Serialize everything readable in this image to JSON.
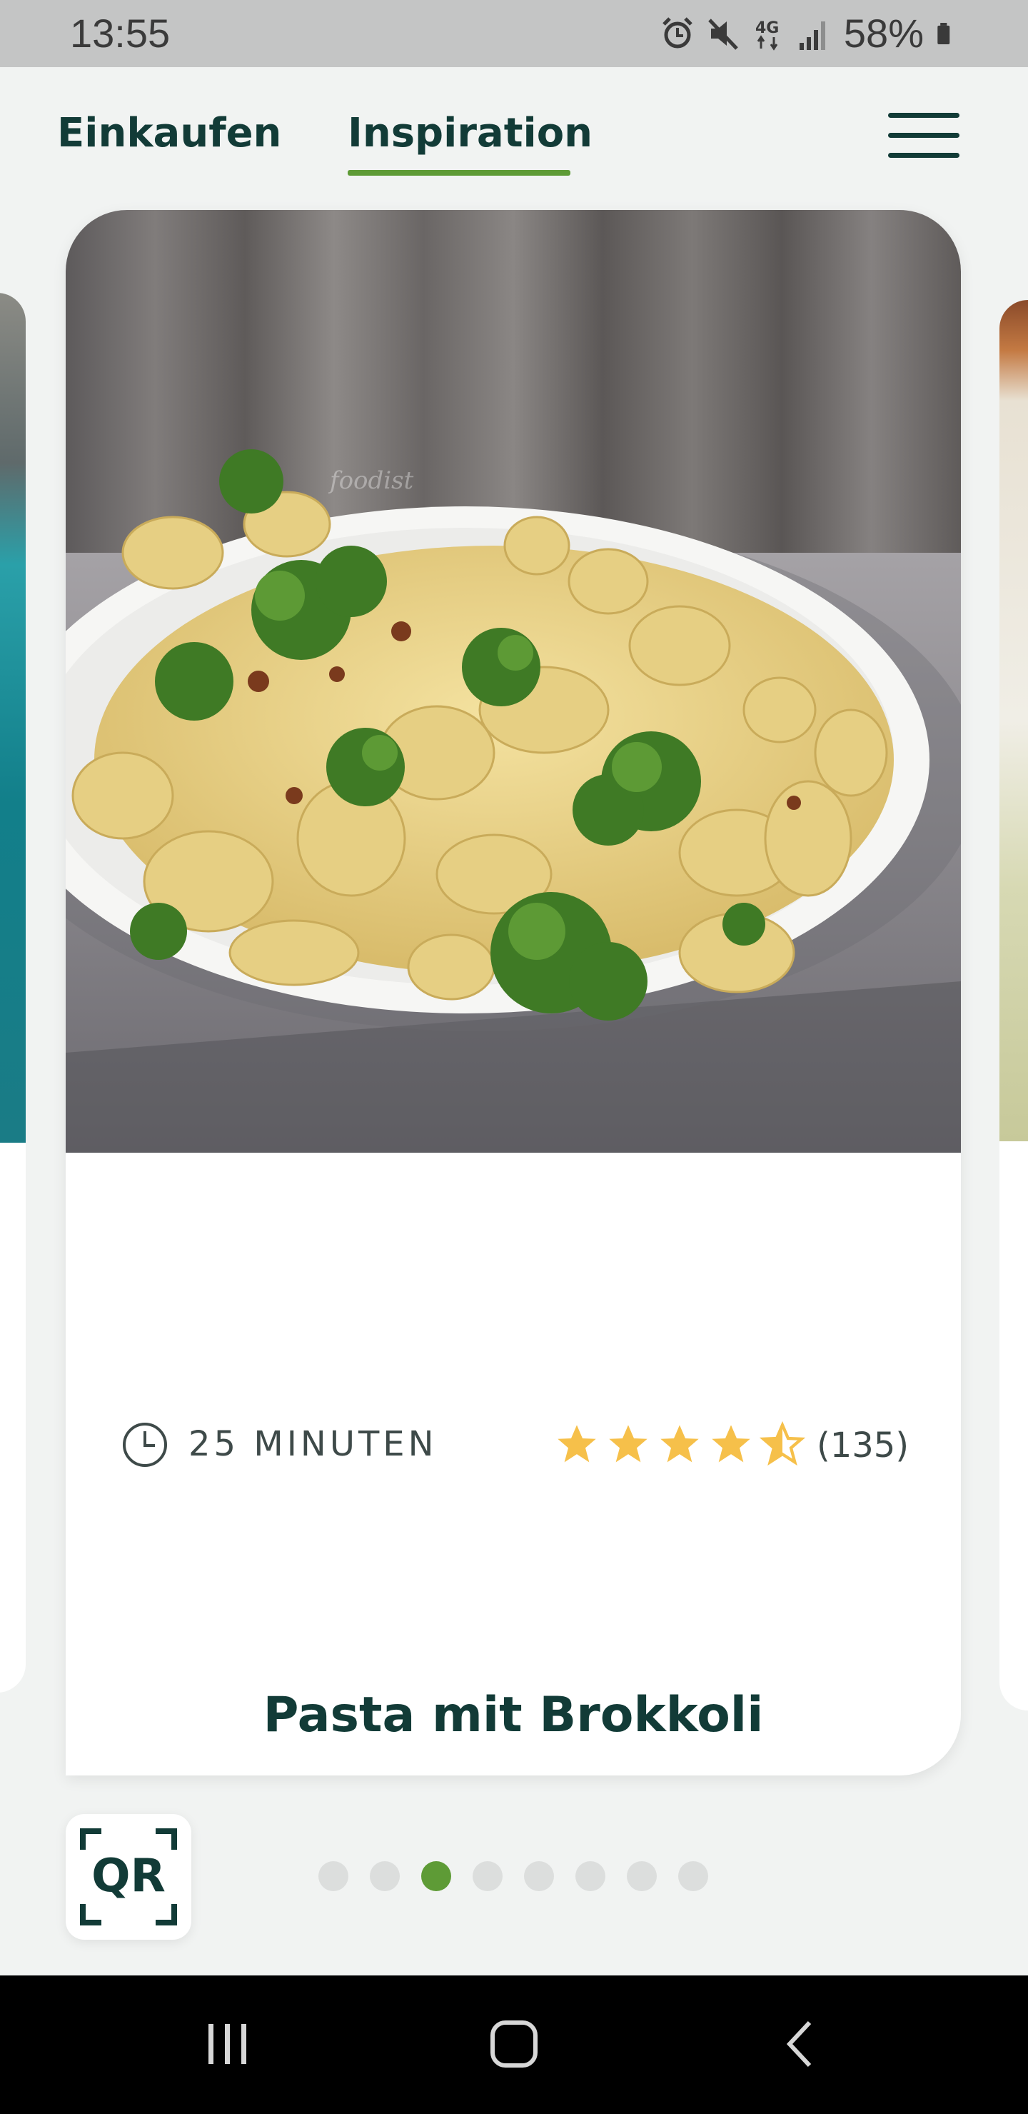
{
  "status_bar": {
    "time": "13:55",
    "network": "4G",
    "battery": "58%",
    "icons": [
      "alarm-icon",
      "mute-icon",
      "4g-icon",
      "signal-icon",
      "battery-icon"
    ]
  },
  "nav": {
    "tabs": [
      {
        "label": "Einkaufen",
        "active": false
      },
      {
        "label": "Inspiration",
        "active": true
      }
    ],
    "menu_icon": "hamburger-menu-icon"
  },
  "recipe": {
    "duration": "25 MINUTEN",
    "rating": 4.5,
    "rating_count": "(135)",
    "title": "Pasta mit Brokkoli",
    "photo_watermark": "foodist"
  },
  "qr_button": {
    "label": "QR"
  },
  "pagination": {
    "total": 8,
    "active_index": 2
  },
  "colors": {
    "brand_dark": "#123b37",
    "accent_green": "#5e9b36",
    "star": "#f6c04a",
    "background": "#f1f3f2"
  }
}
